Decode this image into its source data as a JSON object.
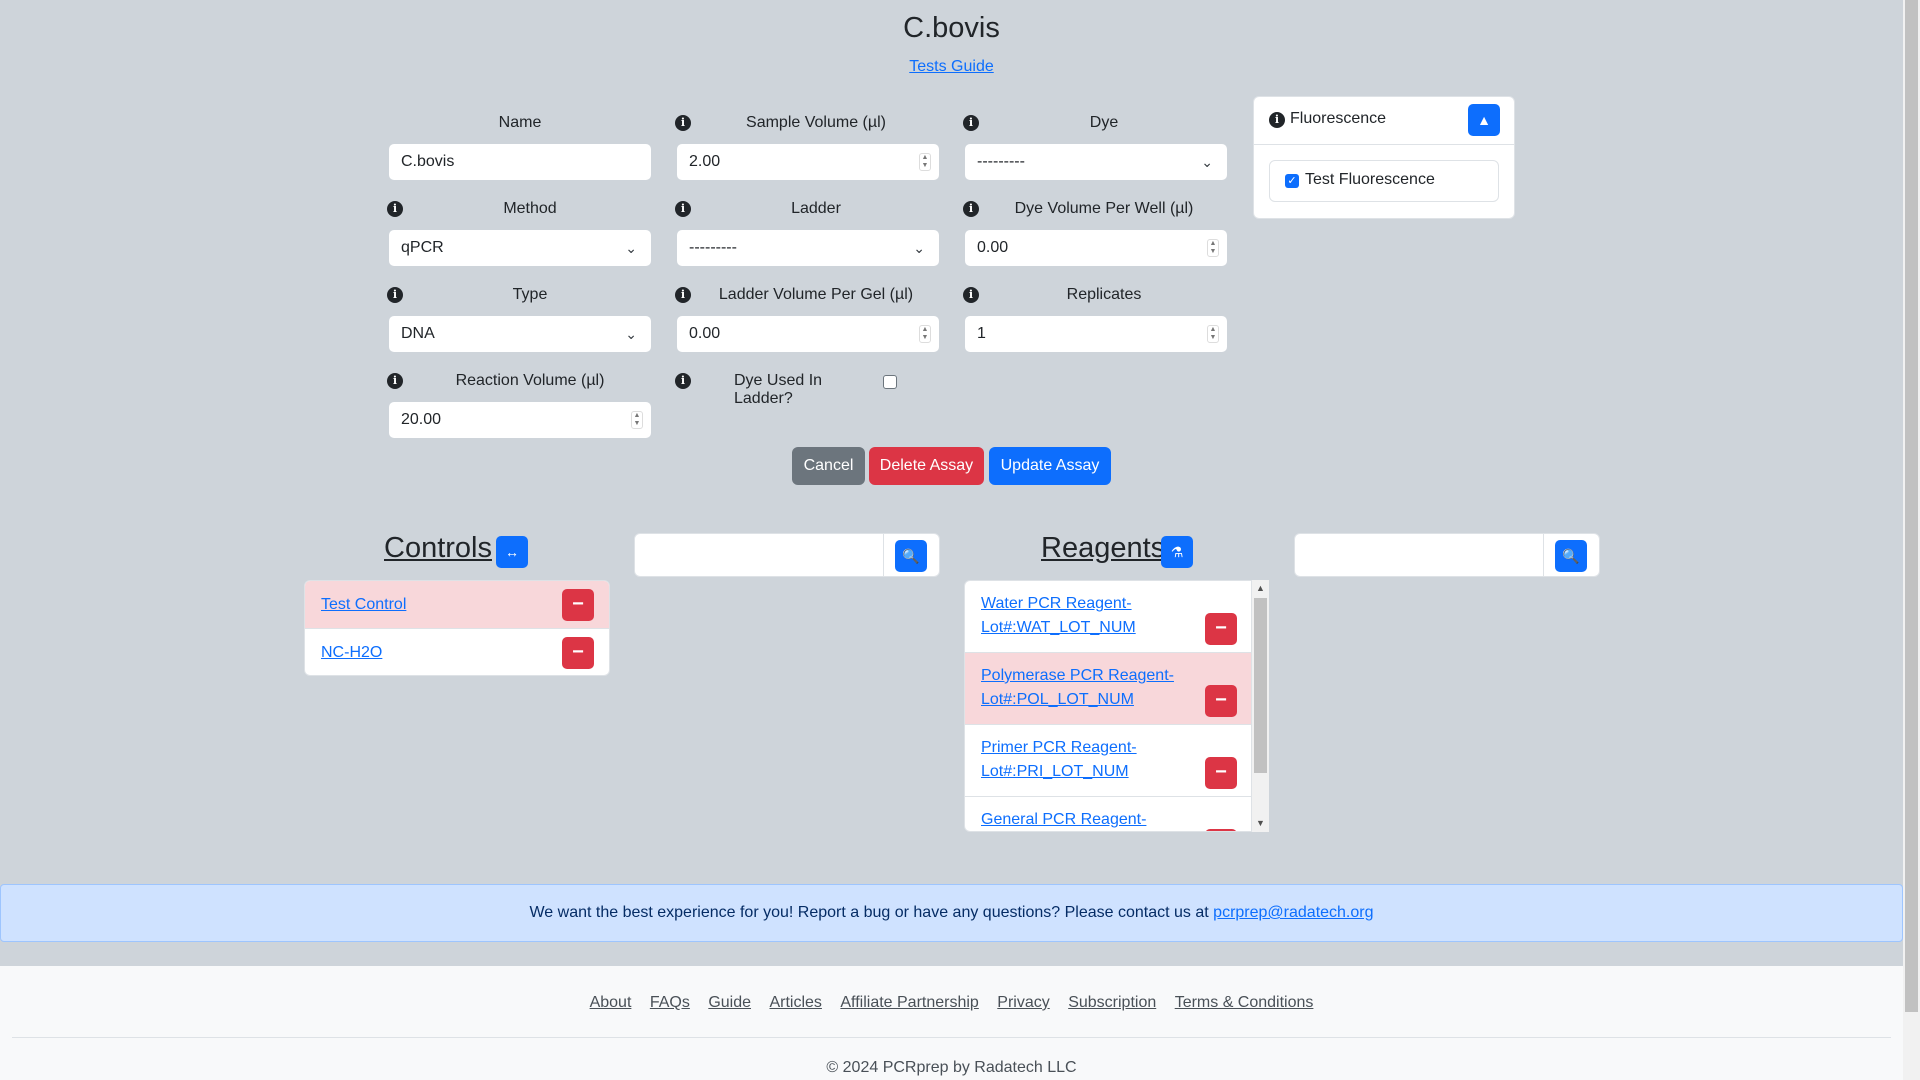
{
  "page": {
    "title": "C.bovis",
    "guide_link": "Tests Guide"
  },
  "form": {
    "name": {
      "label": "Name",
      "value": "C.bovis"
    },
    "sample_volume": {
      "label": "Sample Volume (µl)",
      "value": "2.00"
    },
    "dye": {
      "label": "Dye",
      "value": "---------"
    },
    "method": {
      "label": "Method",
      "value": "qPCR"
    },
    "ladder": {
      "label": "Ladder",
      "value": "---------"
    },
    "dye_volume": {
      "label": "Dye Volume Per Well (µl)",
      "value": "0.00"
    },
    "type": {
      "label": "Type",
      "value": "DNA"
    },
    "ladder_volume": {
      "label": "Ladder Volume Per Gel (µl)",
      "value": "0.00"
    },
    "replicates": {
      "label": "Replicates",
      "value": "1"
    },
    "reaction_volume": {
      "label": "Reaction Volume (µl)",
      "value": "20.00"
    },
    "dye_used_in_ladder": {
      "label": "Dye Used In Ladder?",
      "checked": false
    }
  },
  "fluorescence": {
    "title": "Fluorescence",
    "test_label": "Test Fluorescence",
    "checked": true
  },
  "buttons": {
    "cancel": "Cancel",
    "delete": "Delete Assay",
    "update": "Update Assay"
  },
  "controls": {
    "title": "Controls",
    "items": [
      {
        "label": "Test Control",
        "highlighted": true
      },
      {
        "label": "NC-H2O",
        "highlighted": false
      }
    ]
  },
  "reagents": {
    "title": "Reagents",
    "items": [
      {
        "line1": "Water PCR Reagent-",
        "line2": "Lot#:WAT_LOT_NUM",
        "highlighted": false
      },
      {
        "line1": "Polymerase PCR Reagent-",
        "line2": "Lot#:POL_LOT_NUM",
        "highlighted": true
      },
      {
        "line1": "Primer PCR Reagent-",
        "line2": "Lot#:PRI_LOT_NUM",
        "highlighted": false
      },
      {
        "line1": "General PCR Reagent-",
        "line2": "",
        "highlighted": false
      }
    ]
  },
  "banner": {
    "text": "We want the best experience for you! Report a bug or have any questions? Please contact us at",
    "email": "pcrprep@radatech.org"
  },
  "footer": {
    "links": [
      "About",
      "FAQs",
      "Guide",
      "Articles",
      "Affiliate Partnership",
      "Privacy",
      "Subscription",
      "Terms & Conditions"
    ],
    "copyright": "© 2024 PCRprep by Radatech LLC"
  },
  "colors": {
    "primary": "#0d6efd",
    "danger": "#dc3545",
    "secondary": "#6c757d",
    "page_bg": "#ced4da",
    "highlight_row": "#f8d7da",
    "banner_bg": "#cfe2ff"
  }
}
